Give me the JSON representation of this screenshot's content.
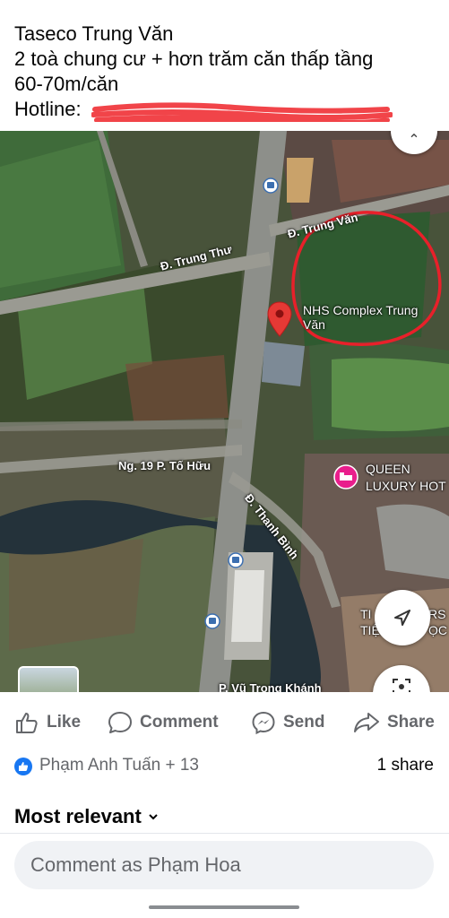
{
  "post": {
    "line1": "Taseco Trung Văn",
    "line2": "2 toà chung cư + hơn trăm căn thấp tầng",
    "line3": "60-70m/căn",
    "hotline_label": "Hotline:"
  },
  "map": {
    "roads": {
      "trung_van": "Đ. Trung Văn",
      "trung_thu": "Đ. Trung Thư",
      "to_huu": "Ng. 19 P. Tố Hữu",
      "thanh_binh": "Đ. Thanh Bình",
      "vu_trong_khanh": "P. Vũ Trọng Khánh"
    },
    "poi": {
      "nhs_line1": "NHS Complex Trung",
      "nhs_line2": "Văn",
      "queen_line1": "QUEEN",
      "queen_line2": "LUXURY HOT",
      "tiem_line1": "TI",
      "tiem_line2": "TIỆM",
      "tiem_right1": "RS",
      "tiem_right2": "ỌC"
    },
    "colors": {
      "annotation_circle": "#e8202a",
      "pin": "#e53935",
      "hotel_pin": "#e91e8c"
    }
  },
  "actions": {
    "like": "Like",
    "comment": "Comment",
    "send": "Send",
    "share": "Share"
  },
  "reactions": {
    "reactors": "Phạm Anh Tuấn + 13",
    "shares": "1 share"
  },
  "comments": {
    "sort": "Most relevant",
    "input_placeholder": "Comment as Phạm Hoa"
  }
}
